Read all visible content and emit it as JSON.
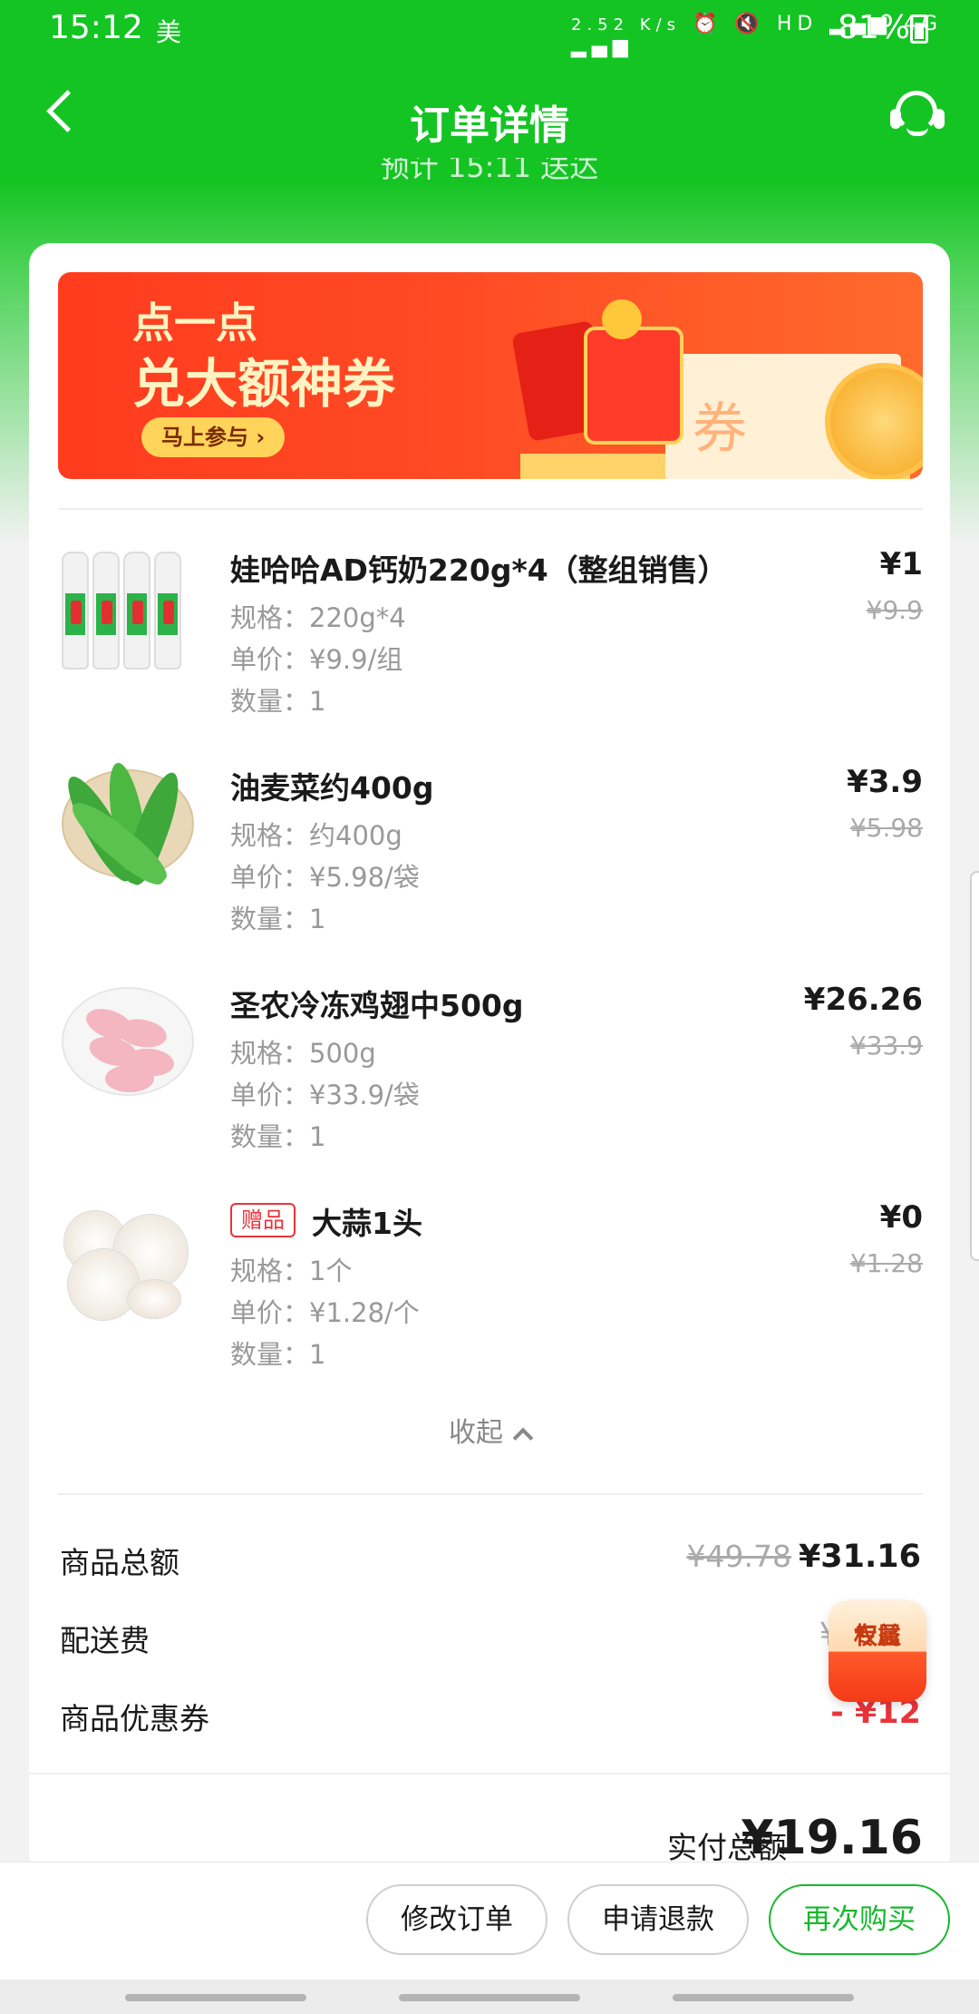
{
  "status_bar": {
    "time": "15:12",
    "carrier": "美",
    "network_speed": "2.52 K/s",
    "icons": [
      "alarm-icon",
      "mute-icon",
      "hd-icon",
      "signal-icon",
      "4g-icon",
      "signal-icon"
    ],
    "icons_text": "⏰ 🔇 HD ▂▄▆ 4G ▂▄▆",
    "battery": "81%"
  },
  "nav": {
    "title": "订单详情",
    "hint": "预计 15:11 送达"
  },
  "banner": {
    "line1": "点一点",
    "line2": "兑大额神券",
    "button": "马上参与 ›"
  },
  "items": [
    {
      "name": "娃哈哈AD钙奶220g*4（整组销售）",
      "spec": "规格：220g*4",
      "unit_price": "单价：¥9.9/组",
      "qty": "数量：1",
      "price": "¥1",
      "original": "¥9.9"
    },
    {
      "name": "油麦菜约400g",
      "spec": "规格：约400g",
      "unit_price": "单价：¥5.98/袋",
      "qty": "数量：1",
      "price": "¥3.9",
      "original": "¥5.98"
    },
    {
      "name": "圣农冷冻鸡翅中500g",
      "spec": "规格：500g",
      "unit_price": "单价：¥33.9/袋",
      "qty": "数量：1",
      "price": "¥26.26",
      "original": "¥33.9"
    },
    {
      "tag": "赠品",
      "name": "大蒜1头",
      "spec": "规格：1个",
      "unit_price": "单价：¥1.28/个",
      "qty": "数量：1",
      "price": "¥0",
      "original": "¥1.28"
    }
  ],
  "collapse_label": "收起",
  "summary": {
    "goods_total_label": "商品总额",
    "goods_total_original": "¥49.78",
    "goods_total": "¥31.16",
    "delivery_label": "配送费",
    "delivery_value": "¥",
    "coupon_label": "商品优惠券",
    "coupon_value": "- ¥12",
    "paid_label": "实付总额",
    "paid_value": "¥19.16"
  },
  "float_badge": {
    "line1": "专属",
    "line2": "权益"
  },
  "actions": {
    "modify": "修改订单",
    "refund": "申请退款",
    "rebuy": "再次购买"
  },
  "colors": {
    "brand_green": "#14c423",
    "accent_red": "#e8343a"
  }
}
